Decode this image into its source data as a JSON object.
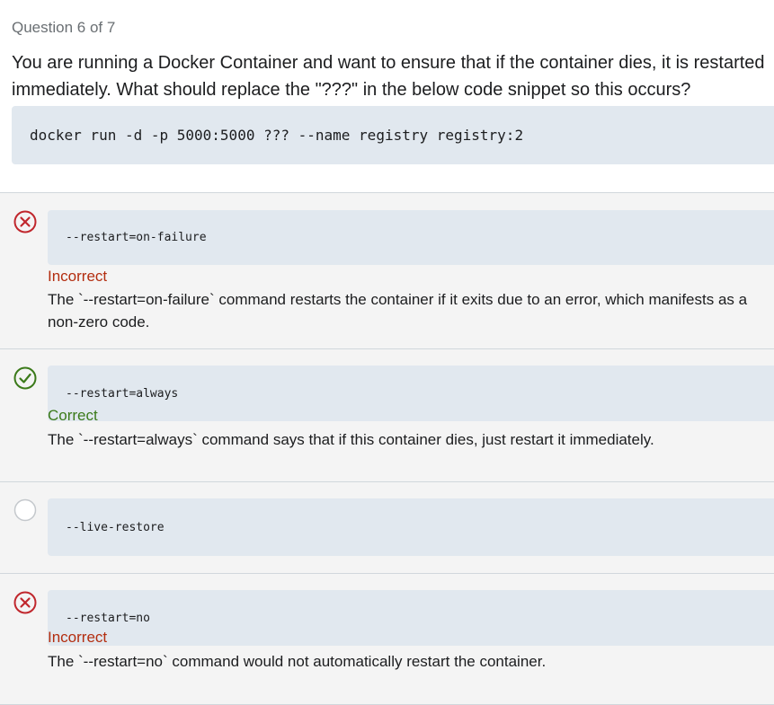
{
  "question": {
    "counter": "Question 6 of 7",
    "text": "You are running a Docker Container and want to ensure that if the container dies, it is restarted immediately. What should replace the \"???\" in the below code snippet so this occurs?",
    "snippet": "docker run -d -p 5000:5000 ??? --name registry registry:2"
  },
  "colors": {
    "incorrect": "#c0272d",
    "correct": "#3b7a1a",
    "code_bg": "#e1e8ef",
    "row_bg": "#f4f4f4"
  },
  "answers": [
    {
      "code": "--restart=on-failure",
      "status": "incorrect",
      "status_icon": "x-circle-icon",
      "verdict": "Incorrect",
      "explanation": "The `--restart=on-failure` command restarts the container if it exits due to an error, which manifests as a non-zero code."
    },
    {
      "code": "--restart=always",
      "status": "correct",
      "status_icon": "check-circle-icon",
      "verdict": "Correct",
      "explanation": "The `--restart=always` command says that if this container dies, just restart it immediately."
    },
    {
      "code": "--live-restore",
      "status": "unselected",
      "status_icon": "empty-circle-icon",
      "verdict": "",
      "explanation": ""
    },
    {
      "code": "--restart=no",
      "status": "incorrect",
      "status_icon": "x-circle-icon",
      "verdict": "Incorrect",
      "explanation": "The `--restart=no` command would not automatically restart the container."
    }
  ]
}
